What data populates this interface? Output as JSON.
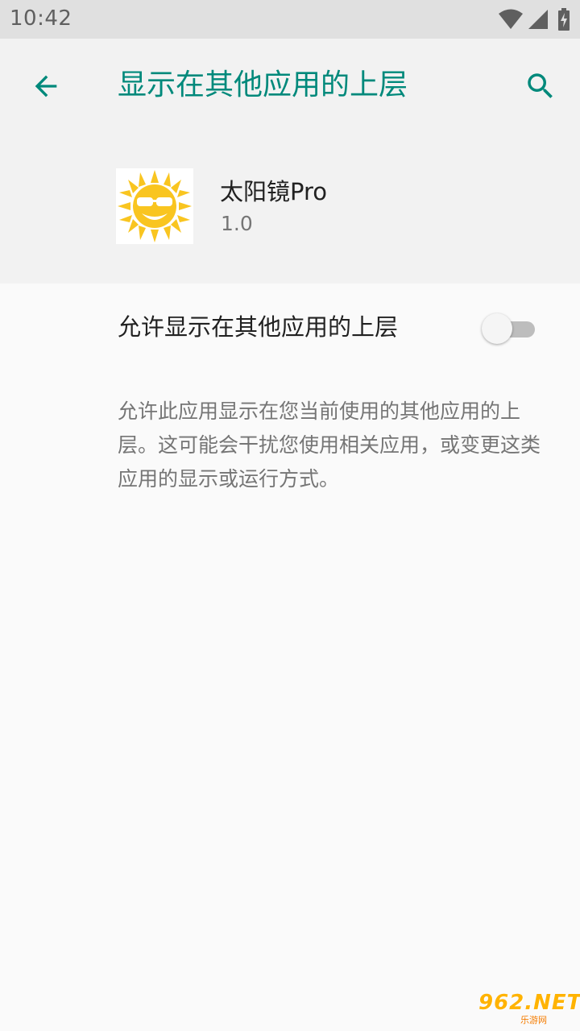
{
  "status_bar": {
    "time": "10:42",
    "icons": [
      "wifi-icon",
      "signal-icon",
      "battery-charging-icon"
    ]
  },
  "header": {
    "title": "显示在其他应用的上层",
    "back_icon": "arrow-back-icon",
    "search_icon": "search-icon",
    "accent_color": "#00897b"
  },
  "app": {
    "name": "太阳镜Pro",
    "version": "1.0",
    "icon": "sun-with-sunglasses-icon"
  },
  "permission": {
    "toggle_label": "允许显示在其他应用的上层",
    "toggle_on": false,
    "description": "允许此应用显示在您当前使用的其他应用的上层。这可能会干扰您使用相关应用，或变更这类应用的显示或运行方式。"
  },
  "watermark": {
    "text": "962.NET",
    "sub": "乐游网"
  }
}
